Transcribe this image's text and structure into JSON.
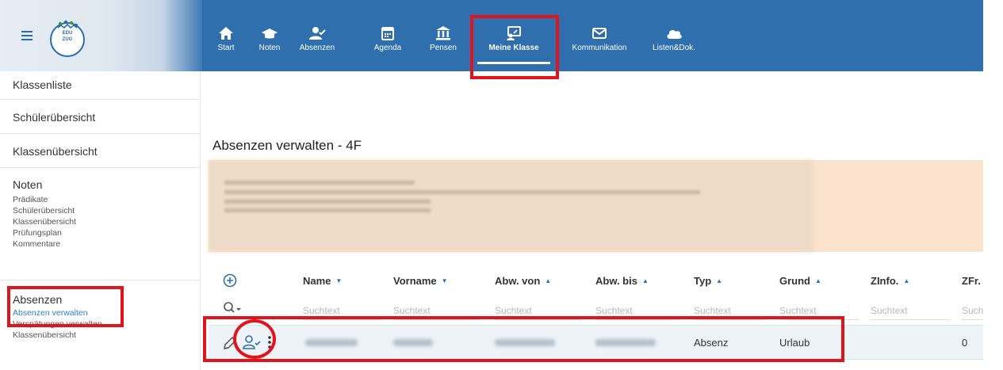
{
  "logo": {
    "line1": "EDU",
    "line2": "ZUG"
  },
  "nav": [
    {
      "label": "Start",
      "icon": "home-icon"
    },
    {
      "label": "Noten",
      "icon": "graduation-cap-icon"
    },
    {
      "label": "Absenzen",
      "icon": "user-check-icon"
    },
    {
      "label": "Agenda",
      "icon": "calendar-icon"
    },
    {
      "label": "Pensen",
      "icon": "institution-icon"
    },
    {
      "label": "Meine Klasse",
      "icon": "class-board-icon",
      "active": true
    },
    {
      "label": "Kommunikation",
      "icon": "envelope-icon"
    },
    {
      "label": "Listen&Dok.",
      "icon": "cloud-icon"
    }
  ],
  "sidebar": {
    "items": [
      {
        "label": "Klassenliste"
      },
      {
        "label": "Schülerübersicht"
      },
      {
        "label": "Klassenübersicht"
      }
    ],
    "noten": {
      "label": "Noten",
      "subs": [
        "Prädikate",
        "Schülerübersicht",
        "Klassenübersicht",
        "Prüfungsplan",
        "Kommentare"
      ]
    },
    "absenzen": {
      "label": "Absenzen",
      "subs": [
        "Absenzen verwalten",
        "Verspätungen verwalten",
        "Klassenübersicht"
      ]
    }
  },
  "main": {
    "title": "Absenzen verwalten - 4F"
  },
  "grid": {
    "columns": [
      {
        "label": "Name",
        "arrow": "▼"
      },
      {
        "label": "Vorname",
        "arrow": "▼"
      },
      {
        "label": "Abw. von",
        "arrow": "▲"
      },
      {
        "label": "Abw. bis",
        "arrow": "▲"
      },
      {
        "label": "Typ",
        "arrow": "▲"
      },
      {
        "label": "Grund",
        "arrow": "▲"
      },
      {
        "label": "ZInfo.",
        "arrow": "▲"
      },
      {
        "label": "ZFr.",
        "arrow": ""
      }
    ],
    "filter_placeholder": "Suchtext",
    "filter_placeholder_cut": "Such",
    "row": {
      "typ": "Absenz",
      "grund": "Urlaub",
      "zfr": "0"
    }
  },
  "colors": {
    "navbar": "#2f6fae",
    "highlight": "#e0141b",
    "info_box": "#fbe3cd",
    "row_selected": "#eef3f8"
  }
}
